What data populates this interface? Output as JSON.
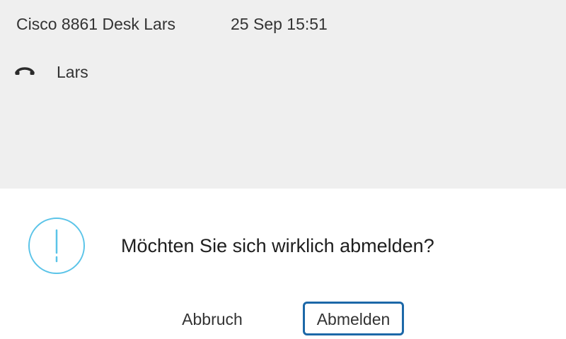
{
  "status_bar": {
    "device_name": "Cisco 8861 Desk Lars",
    "datetime": "25 Sep 15:51"
  },
  "line": {
    "icon": "phone-handset-icon",
    "label": "Lars"
  },
  "dialog": {
    "icon": "alert-exclamation-icon",
    "message": "Möchten Sie sich wirklich abmelden?",
    "cancel_label": "Abbruch",
    "confirm_label": "Abmelden"
  },
  "colors": {
    "top_panel_background": "#efefef",
    "dialog_background": "#ffffff",
    "alert_icon": "#5bc4e8",
    "focus_border": "#1c68a8"
  }
}
